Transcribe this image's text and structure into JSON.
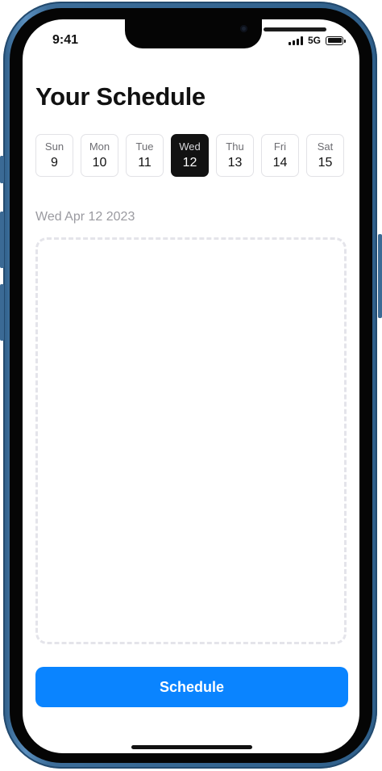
{
  "status_bar": {
    "time": "9:41",
    "network": "5G",
    "signal_bars": 4,
    "battery_level": 1.0
  },
  "page": {
    "title": "Your Schedule"
  },
  "days": [
    {
      "name": "Sun",
      "number": "9",
      "selected": false
    },
    {
      "name": "Mon",
      "number": "10",
      "selected": false
    },
    {
      "name": "Tue",
      "number": "11",
      "selected": false
    },
    {
      "name": "Wed",
      "number": "12",
      "selected": true
    },
    {
      "name": "Thu",
      "number": "13",
      "selected": false
    },
    {
      "name": "Fri",
      "number": "14",
      "selected": false
    },
    {
      "name": "Sat",
      "number": "15",
      "selected": false
    }
  ],
  "selected_date_label": "Wed Apr 12 2023",
  "actions": {
    "schedule_label": "Schedule"
  },
  "colors": {
    "accent": "#0a84ff",
    "selected_chip": "#121212",
    "frame": "#3c6d99"
  },
  "icons": {
    "signal": "cellular-signal-icon",
    "battery": "battery-icon"
  }
}
